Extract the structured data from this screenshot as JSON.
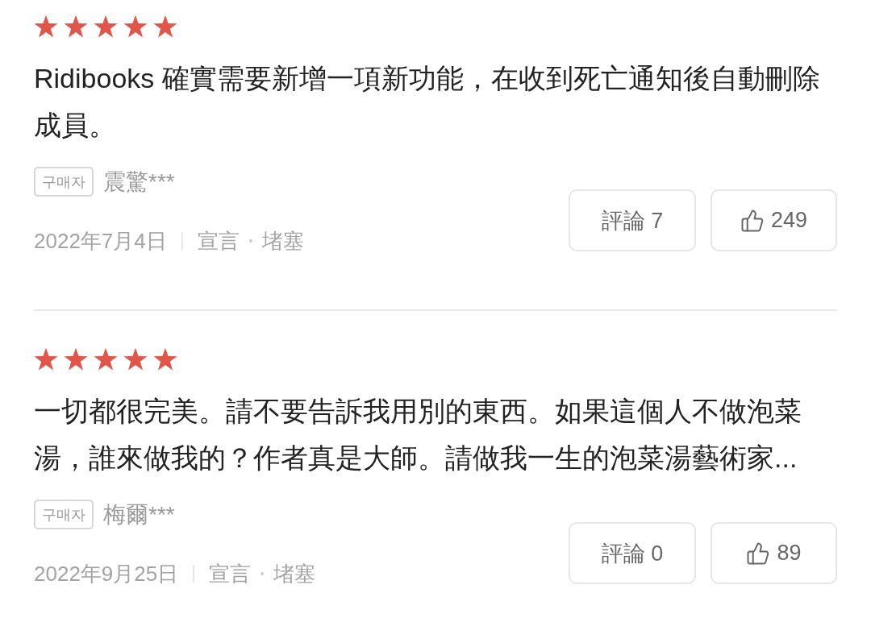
{
  "reviews": [
    {
      "stars": 5,
      "text": "Ridibooks 確實需要新增一項新功能，在收到死亡通知後自動刪除成員。",
      "badge": "구매자",
      "reviewer": "震驚***",
      "date": "2022年7月4日",
      "tags": [
        "宣言",
        "堵塞"
      ],
      "comment_button": "評論 7",
      "like_count": "249"
    },
    {
      "stars": 5,
      "text": "一切都很完美。請不要告訴我用別的東西。如果這個人不做泡菜湯，誰來做我的？作者真是大師。請做我一生的泡菜湯藝術家...",
      "badge": "구매자",
      "reviewer": "梅爾***",
      "date": "2022年9月25日",
      "tags": [
        "宣言",
        "堵塞"
      ],
      "comment_button": "評論 0",
      "like_count": "89"
    }
  ]
}
